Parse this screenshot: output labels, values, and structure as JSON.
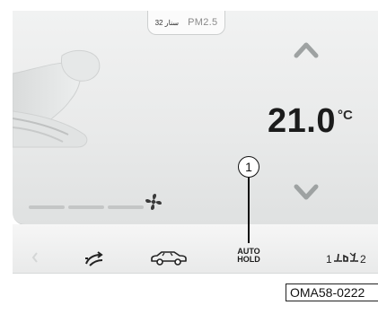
{
  "air_quality": {
    "value": "32 سنار",
    "label": "PM2.5"
  },
  "temperature": {
    "value": "21.0",
    "unit": "°C"
  },
  "fan": {
    "level_fraction": 0.8
  },
  "bottom_bar": {
    "auto_hold_line1": "AUTO",
    "auto_hold_line2": "HOLD"
  },
  "callout": {
    "number": "1"
  },
  "figure_code": "OMA58-0222",
  "icons": {
    "up": "chevron-up-icon",
    "down": "chevron-down-icon",
    "fan": "fan-icon",
    "seat": "seat-airflow-icon",
    "recirculation": "air-recirculation-icon",
    "car": "car-icon",
    "zone": "dual-zone-icon"
  },
  "colors": {
    "screen_bg": "#ececec",
    "text": "#1b1b1b",
    "slider": "#c4c6c6"
  }
}
